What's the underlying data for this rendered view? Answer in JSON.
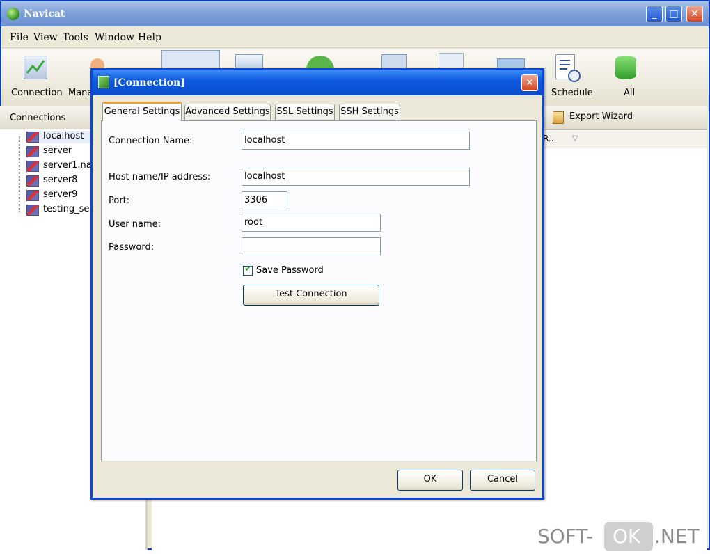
{
  "app": {
    "title": "Navicat"
  },
  "window_controls": {
    "minimize": "_",
    "maximize": "□",
    "close": "✕"
  },
  "menu": [
    "File",
    "View",
    "Tools",
    "Window",
    "Help"
  ],
  "toolbar": {
    "connection": "Connection",
    "manage_users": "Mana",
    "schedule": "Schedule",
    "all": "All"
  },
  "connections_panel": {
    "title": "Connections",
    "items": [
      "localhost",
      "server",
      "server1.na",
      "server8",
      "server9",
      "testing_ser"
    ]
  },
  "right_panel": {
    "export_wizard": "Export Wizard",
    "column_header": "R..."
  },
  "dialog": {
    "title": "[Connection]",
    "close": "✕",
    "tabs": [
      "General Settings",
      "Advanced Settings",
      "SSL Settings",
      "SSH Settings"
    ],
    "fields": {
      "connection_name": {
        "label": "Connection Name:",
        "value": "localhost"
      },
      "host": {
        "label": "Host name/IP address:",
        "value": "localhost"
      },
      "port": {
        "label": "Port:",
        "value": "3306"
      },
      "username": {
        "label": "User name:",
        "value": "root"
      },
      "password": {
        "label": "Password:",
        "value": ""
      }
    },
    "save_password": {
      "label": "Save Password",
      "checked": true
    },
    "test_connection": "Test Connection",
    "ok": "OK",
    "cancel": "Cancel"
  },
  "watermark": {
    "left": "SOFT-",
    "box": "OK",
    "right": ".NET"
  }
}
